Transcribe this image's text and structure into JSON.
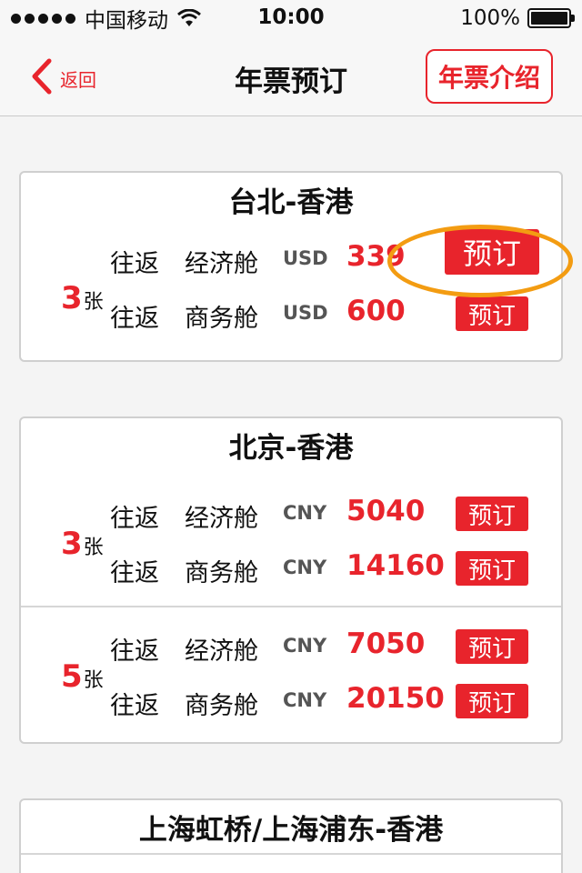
{
  "status_bar": {
    "carrier": "中国移动",
    "time": "10:00",
    "battery_percent": "100%",
    "signal_icon": "signal-dots-icon",
    "wifi_icon": "wifi-icon",
    "battery_icon": "battery-icon"
  },
  "nav": {
    "back_label": "返回",
    "title": "年票预订",
    "intro_button": "年票介绍"
  },
  "accent_color": "#e8242c",
  "highlight_color": "#f39c12",
  "routes": [
    {
      "title": "台北-香港",
      "groups": [
        {
          "qty": "3",
          "unit": "张",
          "fares": [
            {
              "trip": "往返",
              "cabin": "经济舱",
              "currency": "USD",
              "price": "339",
              "book": "预订"
            },
            {
              "trip": "往返",
              "cabin": "商务舱",
              "currency": "USD",
              "price": "600",
              "book": "预订"
            }
          ]
        }
      ]
    },
    {
      "title": "北京-香港",
      "groups": [
        {
          "qty": "3",
          "unit": "张",
          "fares": [
            {
              "trip": "往返",
              "cabin": "经济舱",
              "currency": "CNY",
              "price": "5040",
              "book": "预订"
            },
            {
              "trip": "往返",
              "cabin": "商务舱",
              "currency": "CNY",
              "price": "14160",
              "book": "预订"
            }
          ]
        },
        {
          "qty": "5",
          "unit": "张",
          "fares": [
            {
              "trip": "往返",
              "cabin": "经济舱",
              "currency": "CNY",
              "price": "7050",
              "book": "预订"
            },
            {
              "trip": "往返",
              "cabin": "商务舱",
              "currency": "CNY",
              "price": "20150",
              "book": "预订"
            }
          ]
        }
      ]
    },
    {
      "title": "上海虹桥/上海浦东-香港",
      "groups": []
    }
  ]
}
